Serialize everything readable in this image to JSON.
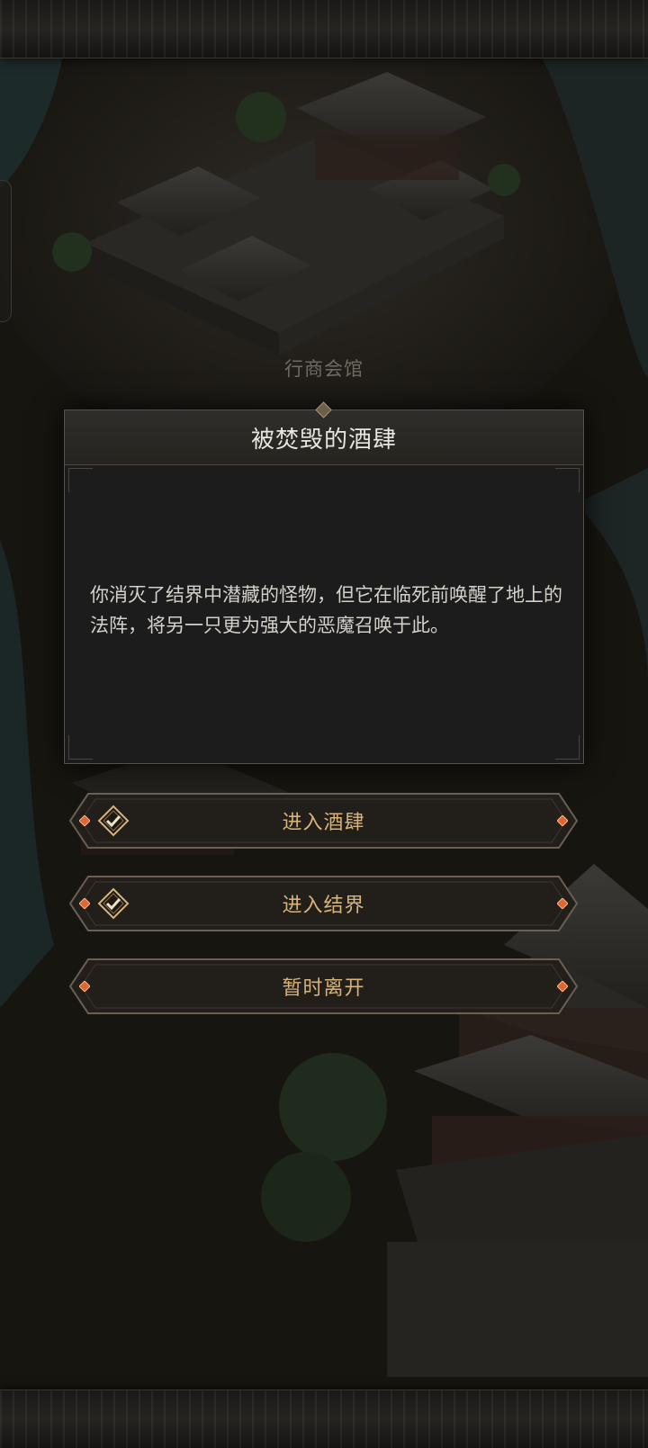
{
  "location": {
    "label": "行商会馆"
  },
  "dialog": {
    "title": "被焚毁的酒肆",
    "body": "你消灭了结界中潜藏的怪物，但它在临死前唤醒了地上的法阵，将另一只更为强大的恶魔召唤于此。"
  },
  "options": [
    {
      "label": "进入酒肆",
      "checked": true
    },
    {
      "label": "进入结界",
      "checked": true
    },
    {
      "label": "暂时离开",
      "checked": false
    }
  ],
  "colors": {
    "option_text": "#d7b27a",
    "gem_accent": "#e0672f",
    "frame": "#6a5f52"
  }
}
